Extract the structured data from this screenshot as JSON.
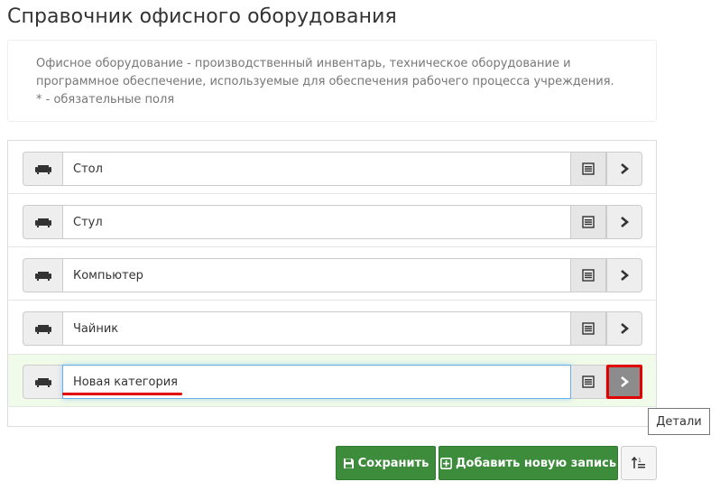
{
  "page": {
    "title": "Справочник офисного оборудования"
  },
  "description": {
    "line1": "Офисное оборудование - производственный инвентарь, техническое оборудование и",
    "line2": "программное обеспечение, используемые для обеспечения рабочего процесса учреждения.",
    "line3": "* - обязательные поля"
  },
  "items": [
    {
      "value": "Стол",
      "icon": "sofa-icon",
      "list_icon": "list-icon",
      "detail_icon": "chevron-right-icon"
    },
    {
      "value": "Стул",
      "icon": "sofa-icon",
      "list_icon": "list-icon",
      "detail_icon": "chevron-right-icon"
    },
    {
      "value": "Компьютер",
      "icon": "sofa-icon",
      "list_icon": "list-icon",
      "detail_icon": "chevron-right-icon"
    },
    {
      "value": "Чайник",
      "icon": "sofa-icon",
      "list_icon": "list-icon",
      "detail_icon": "chevron-right-icon"
    },
    {
      "value": "Новая категория",
      "icon": "sofa-icon",
      "list_icon": "list-icon",
      "detail_icon": "chevron-right-icon",
      "state": "new"
    }
  ],
  "tooltip": {
    "text": "Детали"
  },
  "actions": {
    "save_label": "Сохранить",
    "save_icon": "floppy-disk-icon",
    "add_label": "Добавить новую запись",
    "add_icon": "plus-square-icon",
    "sort_icon": "sort-numeric-icon"
  },
  "colors": {
    "primary_button": "#3c8c3c",
    "highlight_row": "#f1fbe9",
    "annotation": "#e00000"
  }
}
